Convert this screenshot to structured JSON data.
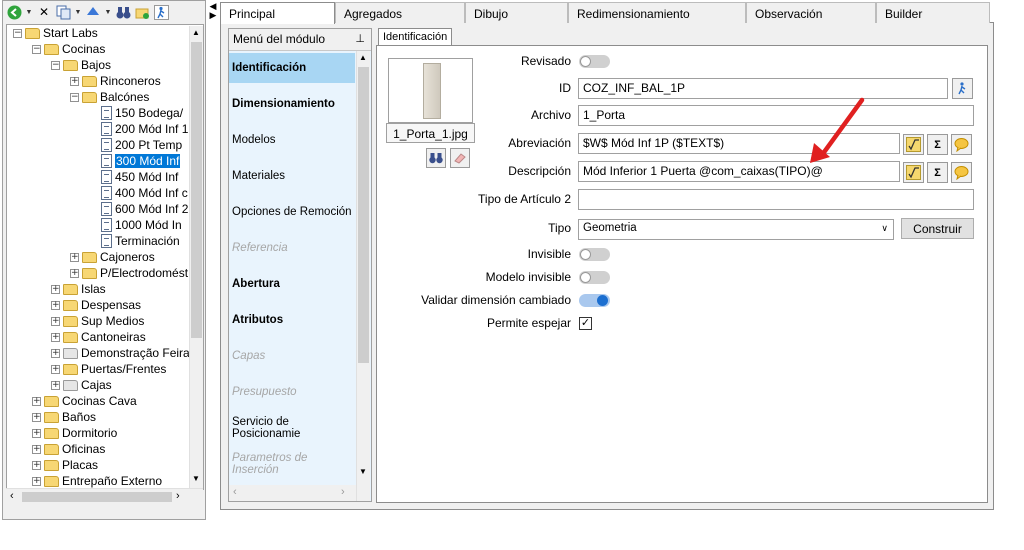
{
  "tree": {
    "items": [
      {
        "label": "Start Labs",
        "level": 0,
        "exp": "-",
        "icon": "folder-open",
        "selected": false
      },
      {
        "label": "Cocinas",
        "level": 1,
        "exp": "-",
        "icon": "folder-open",
        "selected": false
      },
      {
        "label": "Bajos",
        "level": 2,
        "exp": "-",
        "icon": "folder-open",
        "selected": false
      },
      {
        "label": "Rinconeros",
        "level": 3,
        "exp": "+",
        "icon": "folder",
        "selected": false
      },
      {
        "label": "Balcónes",
        "level": 3,
        "exp": "-",
        "icon": "folder-open",
        "selected": false
      },
      {
        "label": "150 Bodega/",
        "level": 4,
        "exp": "",
        "icon": "doc",
        "selected": false
      },
      {
        "label": "200 Mód Inf 1",
        "level": 4,
        "exp": "",
        "icon": "doc",
        "selected": false
      },
      {
        "label": "200 Pt Temp",
        "level": 4,
        "exp": "",
        "icon": "doc",
        "selected": false
      },
      {
        "label": "300 Mód Inf",
        "level": 4,
        "exp": "",
        "icon": "doc",
        "selected": true
      },
      {
        "label": "450 Mód Inf",
        "level": 4,
        "exp": "",
        "icon": "doc",
        "selected": false
      },
      {
        "label": "400 Mód Inf c",
        "level": 4,
        "exp": "",
        "icon": "doc",
        "selected": false
      },
      {
        "label": "600 Mód Inf 2",
        "level": 4,
        "exp": "",
        "icon": "doc",
        "selected": false
      },
      {
        "label": "1000 Mód In",
        "level": 4,
        "exp": "",
        "icon": "doc",
        "selected": false
      },
      {
        "label": "Terminación",
        "level": 4,
        "exp": "",
        "icon": "doc",
        "selected": false
      },
      {
        "label": "Cajoneros",
        "level": 3,
        "exp": "+",
        "icon": "folder",
        "selected": false
      },
      {
        "label": "P/Electrodomést",
        "level": 3,
        "exp": "+",
        "icon": "folder",
        "selected": false
      },
      {
        "label": "Islas",
        "level": 2,
        "exp": "+",
        "icon": "folder",
        "selected": false
      },
      {
        "label": "Despensas",
        "level": 2,
        "exp": "+",
        "icon": "folder",
        "selected": false
      },
      {
        "label": "Sup Medios",
        "level": 2,
        "exp": "+",
        "icon": "folder",
        "selected": false
      },
      {
        "label": "Cantoneiras",
        "level": 2,
        "exp": "+",
        "icon": "folder",
        "selected": false
      },
      {
        "label": "Demonstração Feira",
        "level": 2,
        "exp": "+",
        "icon": "folder-grey",
        "selected": false
      },
      {
        "label": "Puertas/Frentes",
        "level": 2,
        "exp": "+",
        "icon": "folder",
        "selected": false
      },
      {
        "label": "Cajas",
        "level": 2,
        "exp": "+",
        "icon": "folder-grey",
        "selected": false
      },
      {
        "label": "Cocinas Cava",
        "level": 1,
        "exp": "+",
        "icon": "folder",
        "selected": false
      },
      {
        "label": "Baños",
        "level": 1,
        "exp": "+",
        "icon": "folder",
        "selected": false
      },
      {
        "label": "Dormitorio",
        "level": 1,
        "exp": "+",
        "icon": "folder",
        "selected": false
      },
      {
        "label": "Oficinas",
        "level": 1,
        "exp": "+",
        "icon": "folder",
        "selected": false
      },
      {
        "label": "Placas",
        "level": 1,
        "exp": "+",
        "icon": "folder",
        "selected": false
      },
      {
        "label": "Entrepaño Externo",
        "level": 1,
        "exp": "+",
        "icon": "folder",
        "selected": false
      }
    ]
  },
  "tabs": [
    "Principal",
    "Agregados",
    "Dibujo",
    "Redimensionamiento",
    "Observación",
    "Builder"
  ],
  "module_menu": {
    "header": "Menú del módulo",
    "items": [
      {
        "label": "Identificación",
        "style": "active"
      },
      {
        "label": "Dimensionamiento",
        "style": "bold"
      },
      {
        "label": "Modelos",
        "style": "normal"
      },
      {
        "label": "Materiales",
        "style": "normal"
      },
      {
        "label": "Opciones de Remoción",
        "style": "normal"
      },
      {
        "label": "Referencia",
        "style": "disabled"
      },
      {
        "label": "Abertura",
        "style": "bold"
      },
      {
        "label": "Atributos",
        "style": "bold"
      },
      {
        "label": "Capas",
        "style": "disabled"
      },
      {
        "label": "Presupuesto",
        "style": "disabled"
      },
      {
        "label": "Servicio de Posicionamie",
        "style": "normal"
      },
      {
        "label": "Parametros de Inserción",
        "style": "disabled"
      }
    ]
  },
  "ident": {
    "tab_label": "Identificación",
    "image_name": "1_Porta_1.jpg",
    "revisado_label": "Revisado",
    "id_label": "ID",
    "id_value": "COZ_INF_BAL_1P",
    "archivo_label": "Archivo",
    "archivo_value": "1_Porta",
    "abreviacion_label": "Abreviación",
    "abreviacion_value": "$W$ Mód Inf 1P ($TEXT$)",
    "descripcion_label": "Descripción",
    "descripcion_value": "Mód Inferior 1 Puerta @com_caixas(TIPO)@",
    "tipo2_label": "Tipo de Artículo 2",
    "tipo2_value": "",
    "tipo_label": "Tipo",
    "tipo_value": "Geometria",
    "construir_label": "Construir",
    "invisible_label": "Invisible",
    "modelo_invisible_label": "Modelo invisible",
    "validar_label": "Validar dimensión cambiado",
    "permite_label": "Permite espejar",
    "sigma": "Σ",
    "revisado_on": false,
    "invisible_on": false,
    "modelo_invisible_on": false,
    "validar_on": true,
    "permite_checked": true
  },
  "colors": {
    "selection": "#0078d7",
    "menu_active": "#a8d6f3",
    "menu_bg": "#e9f4fd",
    "annotation_arrow": "#e02020"
  }
}
